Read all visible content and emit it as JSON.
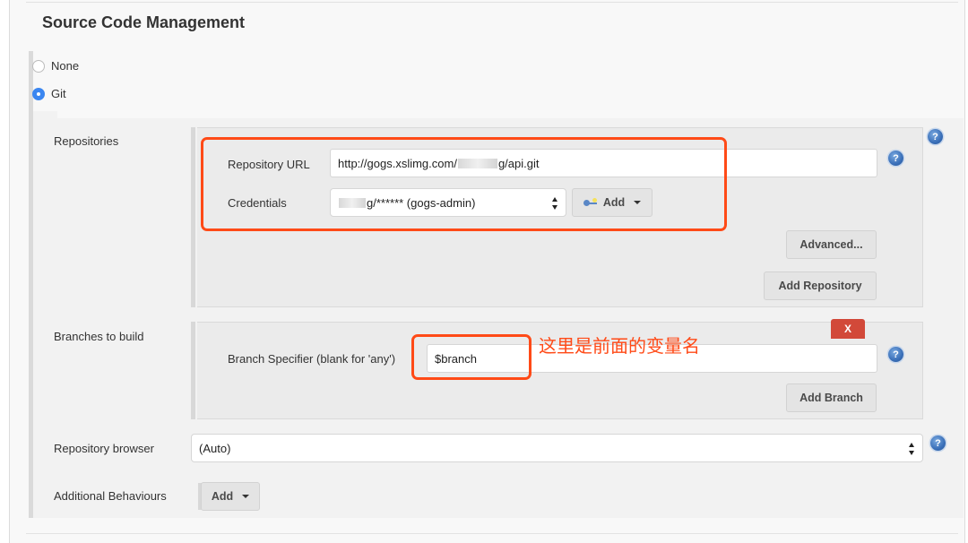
{
  "section": {
    "title": "Source Code Management"
  },
  "scm_options": [
    {
      "label": "None",
      "selected": false
    },
    {
      "label": "Git",
      "selected": true
    }
  ],
  "repositories": {
    "label": "Repositories",
    "url_label": "Repository URL",
    "url_value_prefix": "http://gogs.xslimg.com/",
    "url_value_suffix": "g/api.git",
    "credentials_label": "Credentials",
    "credentials_value_suffix": "g/****** (gogs-admin)",
    "add_credentials_label": "Add",
    "advanced_label": "Advanced...",
    "add_repository_label": "Add Repository"
  },
  "branches": {
    "label": "Branches to build",
    "specifier_label": "Branch Specifier (blank for 'any')",
    "specifier_value": "$branch",
    "delete_label": "X",
    "add_branch_label": "Add Branch"
  },
  "repo_browser": {
    "label": "Repository browser",
    "value": "(Auto)"
  },
  "additional_behaviours": {
    "label": "Additional Behaviours",
    "add_label": "Add"
  },
  "annotation": {
    "text": "这里是前面的变量名",
    "color": "#ff4a17"
  },
  "colors": {
    "radio_selected": "#3b86f0",
    "delete_button": "#d24939",
    "help_icon": "#3a6fb8"
  },
  "icons": {
    "help": "?",
    "credentials_add": "key-icon",
    "dropdown": "caret-down"
  }
}
